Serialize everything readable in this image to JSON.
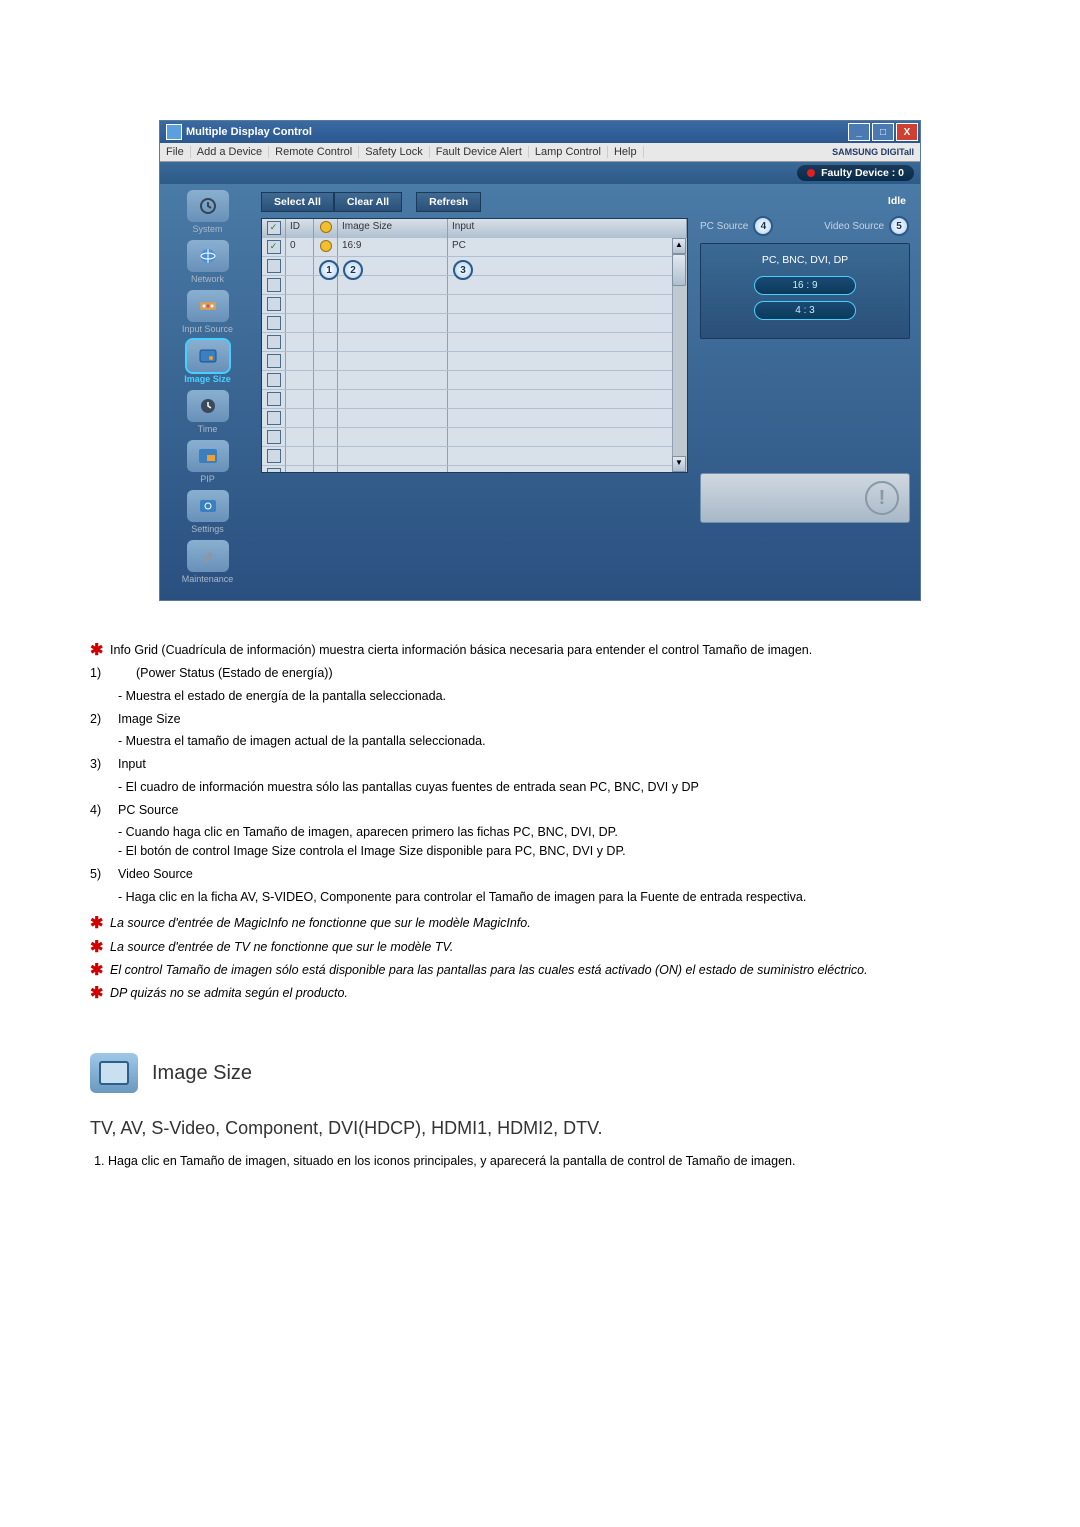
{
  "app": {
    "title": "Multiple Display Control",
    "brand": "SAMSUNG DIGITall",
    "menus": [
      "File",
      "Add a Device",
      "Remote Control",
      "Safety Lock",
      "Fault Device Alert",
      "Lamp Control",
      "Help"
    ],
    "faulty_label": "Faulty Device : 0",
    "idle_label": "Idle",
    "buttons": {
      "select_all": "Select All",
      "clear_all": "Clear All",
      "refresh": "Refresh"
    },
    "sidebar": [
      {
        "key": "system",
        "label": "System"
      },
      {
        "key": "network",
        "label": "Network"
      },
      {
        "key": "input-source",
        "label": "Input Source"
      },
      {
        "key": "image-size",
        "label": "Image Size"
      },
      {
        "key": "time",
        "label": "Time"
      },
      {
        "key": "pip",
        "label": "PIP"
      },
      {
        "key": "settings",
        "label": "Settings"
      },
      {
        "key": "maintenance",
        "label": "Maintenance"
      }
    ],
    "grid": {
      "headers": {
        "id": "ID",
        "size": "Image Size",
        "input": "Input"
      },
      "row": {
        "id": "0",
        "size": "16:9",
        "input": "PC"
      },
      "badges": {
        "b1": "1",
        "b2": "2",
        "b3": "3"
      }
    },
    "right": {
      "tabs": {
        "pc": "PC Source",
        "video": "Video Source",
        "b4": "4",
        "b5": "5"
      },
      "panel_title": "PC, BNC, DVI, DP",
      "opt1": "16 : 9",
      "opt2": "4 : 3"
    }
  },
  "doc": {
    "intro": "Info Grid (Cuadrícula de información) muestra cierta información básica necesaria para entender el control Tamaño de imagen.",
    "items": {
      "n1": "1)",
      "t1": "(Power Status (Estado de energía))",
      "d1": "- Muestra el estado de energía de la pantalla seleccionada.",
      "n2": "2)",
      "t2": "Image Size",
      "d2": "- Muestra el tamaño de imagen actual de la pantalla seleccionada.",
      "n3": "3)",
      "t3": "Input",
      "d3": "- El cuadro de información muestra sólo las pantallas cuyas fuentes de entrada sean PC, BNC, DVI y DP",
      "n4": "4)",
      "t4": "PC Source",
      "d4a": "- Cuando haga clic en Tamaño de imagen, aparecen primero las fichas PC, BNC, DVI, DP.",
      "d4b": "- El botón de control Image Size controla el Image Size disponible para PC, BNC, DVI y DP.",
      "n5": "5)",
      "t5": "Video Source",
      "d5": "- Haga clic en la ficha AV, S-VIDEO, Componente para controlar el Tamaño de imagen para la Fuente de entrada respectiva."
    },
    "stars": {
      "s1": "La source d'entrée de MagicInfo ne fonctionne que sur le modèle MagicInfo.",
      "s2": "La source d'entrée de TV ne fonctionne que sur le modèle TV.",
      "s3": "El control Tamaño de imagen sólo está disponible para las pantallas para las cuales está activado (ON) el estado de suministro eléctrico.",
      "s4": "DP quizás no se admita según el producto."
    },
    "sect_title": "Image Size",
    "sect_sub": "TV, AV, S-Video, Component, DVI(HDCP), HDMI1, HDMI2, DTV.",
    "sect_li1": "Haga clic en Tamaño de imagen, situado en los iconos principales, y aparecerá la pantalla de control de Tamaño de imagen."
  }
}
